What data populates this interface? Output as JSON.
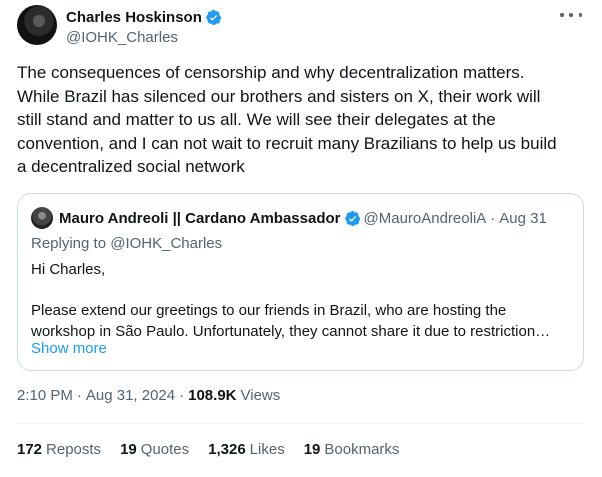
{
  "author": {
    "name": "Charles Hoskinson",
    "handle": "@IOHK_Charles"
  },
  "tweet": {
    "text": "The consequences of censorship and why decentralization matters.\nWhile Brazil has silenced our brothers and sisters on X, their work will\nstill stand and matter to us all. We will see their delegates at the\nconvention, and I can not wait to recruit many Brazilians to help us build\na decentralized social network"
  },
  "quote": {
    "name": "Mauro Andreoli || Cardano Ambassador",
    "handle": "@MauroAndreoliA",
    "dot": "·",
    "date": "Aug 31",
    "replying_prefix": "Replying to ",
    "replying_to": "@IOHK_Charles",
    "greeting": "Hi Charles,",
    "body_line1": "Please extend our greetings to our friends in Brazil, who are hosting the",
    "body_line2": "workshop in São Paulo. Unfortunately, they cannot share it due to restriction…",
    "show_more": "Show more"
  },
  "meta": {
    "time": "2:10 PM",
    "sep": "·",
    "date": "Aug 31, 2024",
    "sep2": "·",
    "views_count": "108.9K",
    "views_label": "Views"
  },
  "stats": {
    "reposts_count": "172",
    "reposts_label": "Reposts",
    "quotes_count": "19",
    "quotes_label": "Quotes",
    "likes_count": "1,326",
    "likes_label": "Likes",
    "bookmarks_count": "19",
    "bookmarks_label": "Bookmarks"
  },
  "colors": {
    "verified": "#1d9bf0",
    "link": "#1d9bf0",
    "secondary_text": "#536471"
  },
  "icons": {
    "verified": "verified-badge-icon",
    "more": "more-horizontal-icon"
  }
}
